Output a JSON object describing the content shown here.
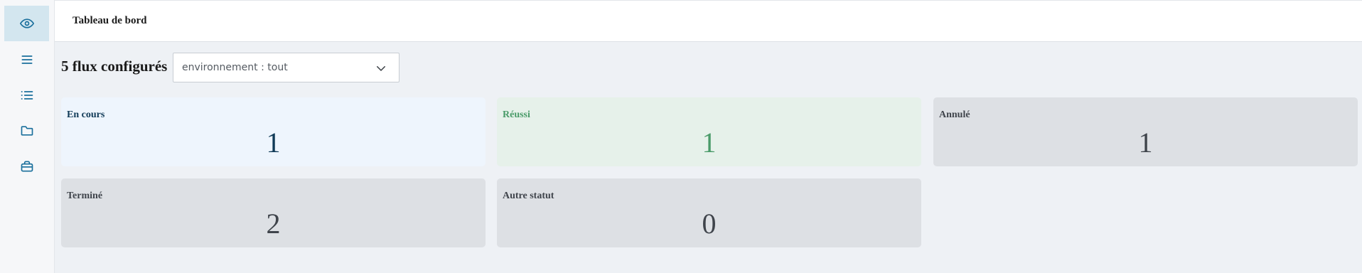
{
  "sidebar": {
    "items": [
      {
        "icon": "eye-icon",
        "active": true
      },
      {
        "icon": "menu-icon",
        "active": false
      },
      {
        "icon": "list-icon",
        "active": false
      },
      {
        "icon": "folder-icon",
        "active": false
      },
      {
        "icon": "briefcase-icon",
        "active": false
      }
    ]
  },
  "header": {
    "title": "Tableau de bord"
  },
  "toolbar": {
    "flux_count": "5 flux configurés",
    "environment_select": "environnement : tout"
  },
  "status_cards": [
    {
      "label": "En cours",
      "value": "1",
      "color": "#103a57",
      "background": "#eef5fd"
    },
    {
      "label": "Réussi",
      "value": "1",
      "color": "#4a9b69",
      "background": "#e6f1ea"
    },
    {
      "label": "Annulé",
      "value": "1",
      "color": "#3f444b",
      "background": "#dde0e4"
    },
    {
      "label": "Terminé",
      "value": "2",
      "color": "#3f444b",
      "background": "#dde0e4"
    },
    {
      "label": "Autre statut",
      "value": "0",
      "color": "#3f444b",
      "background": "#dde0e4"
    }
  ],
  "colors": {
    "accent": "#1a6f9c",
    "sidebar_active": "#d3e6ef",
    "main_background": "#eef1f5"
  }
}
